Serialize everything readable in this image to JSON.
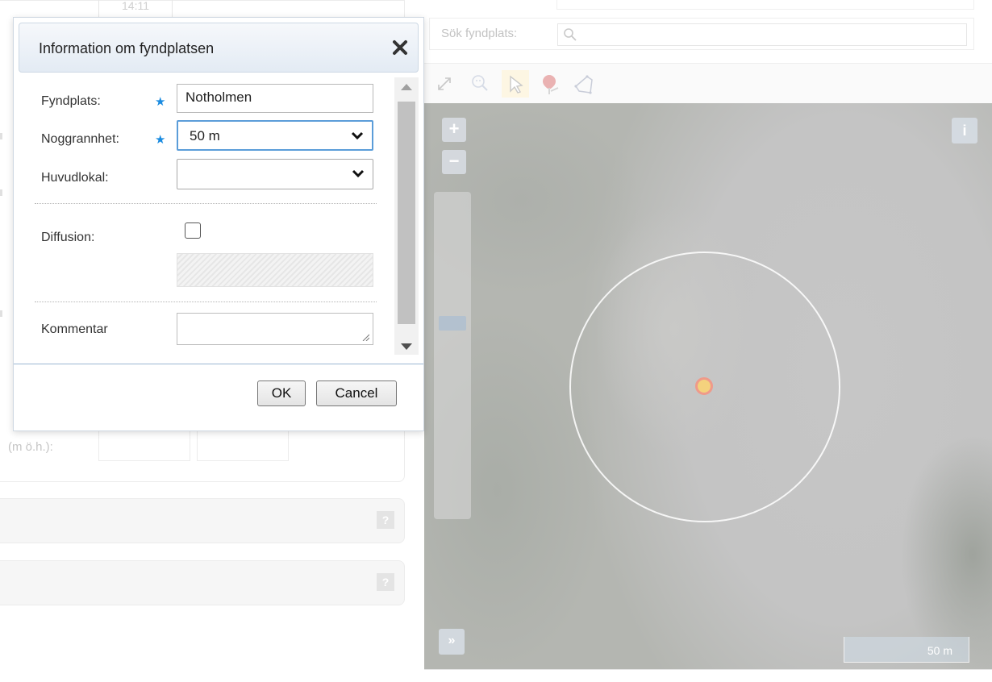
{
  "background_form": {
    "time_value": "14:11",
    "altitude_label": "(m ö.h.):",
    "help_icon_text": "?"
  },
  "search": {
    "label": "Sök fyndplats:",
    "placeholder": ""
  },
  "toolbar": {
    "tools": [
      "fullscreen-icon",
      "zoom-to-extent-icon",
      "select-pointer-icon",
      "place-marker-icon",
      "draw-polygon-icon"
    ]
  },
  "map": {
    "zoom_in": "+",
    "zoom_out": "−",
    "info": "i",
    "expand": "»",
    "scale_label": "50 m"
  },
  "dialog": {
    "title": "Information om fyndplatsen",
    "fields": {
      "fyndplats_label": "Fyndplats:",
      "fyndplats_value": "Notholmen",
      "noggrannhet_label": "Noggrannhet:",
      "noggrannhet_value": "50 m",
      "huvudlokal_label": "Huvudlokal:",
      "huvudlokal_value": "",
      "diffusion_label": "Diffusion:",
      "kommentar_label": "Kommentar",
      "kommentar_value": ""
    },
    "required_marker": "★",
    "ok_label": "OK",
    "cancel_label": "Cancel"
  }
}
